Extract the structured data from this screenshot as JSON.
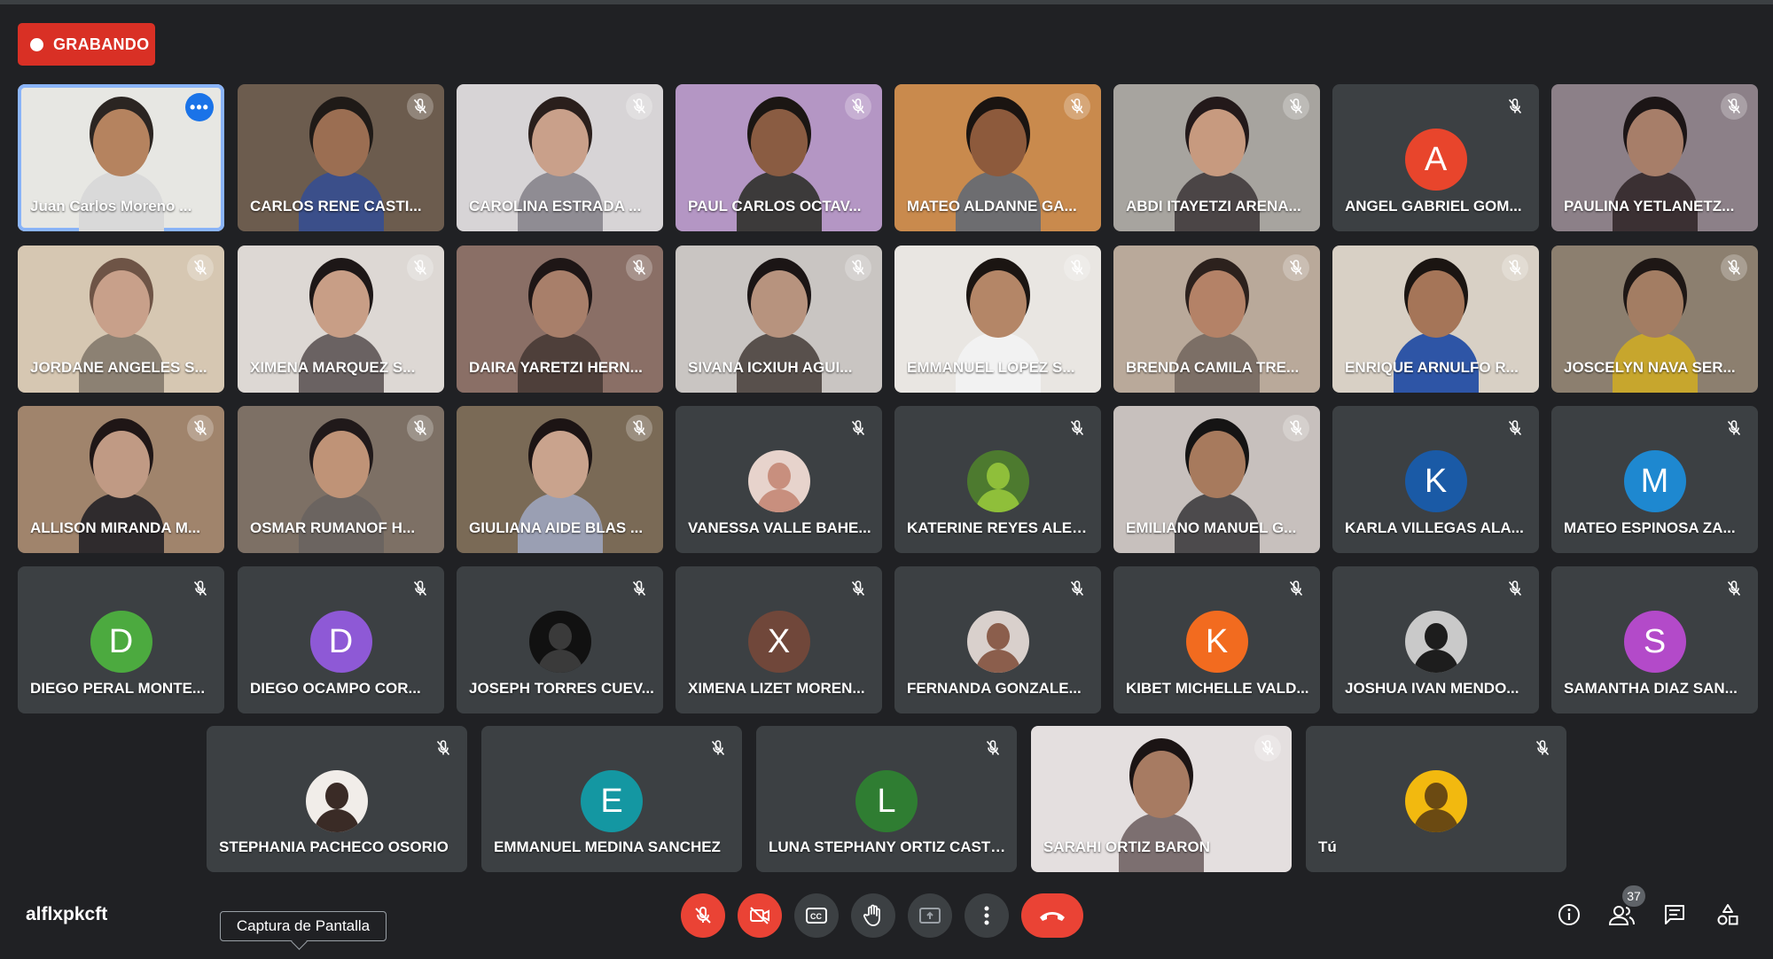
{
  "recording": {
    "label": "GRABANDO"
  },
  "meeting_code": "alflxpkcft",
  "tooltip": "Captura de Pantalla",
  "participants_count": "37",
  "participants": [
    {
      "name": "Juan Carlos Moreno ...",
      "kind": "video",
      "active": true,
      "bg": "#e7e7e3",
      "skin": "#b5835f",
      "hair": "#2b2522",
      "shirt": "#d9d9d9"
    },
    {
      "name": "CARLOS RENE CASTI...",
      "kind": "video",
      "bg": "#6c5c4e",
      "skin": "#9b6e52",
      "hair": "#1f1a17",
      "shirt": "#3b4f8a"
    },
    {
      "name": "CAROLINA ESTRADA ...",
      "kind": "video",
      "bg": "#d7d4d6",
      "skin": "#c9a08a",
      "hair": "#2a1f1c",
      "shirt": "#8f8c93"
    },
    {
      "name": "PAUL CARLOS OCTAV...",
      "kind": "video",
      "bg": "#b496c4",
      "skin": "#8a5c42",
      "hair": "#1b1613",
      "shirt": "#3c3a3a"
    },
    {
      "name": "MATEO ALDANNE GA...",
      "kind": "video",
      "bg": "#c98a4d",
      "skin": "#8d5a3c",
      "hair": "#1a1411",
      "shirt": "#6d6d70"
    },
    {
      "name": "ABDI ITAYETZI ARENA...",
      "kind": "video",
      "bg": "#a7a49f",
      "skin": "#c79a7f",
      "hair": "#23191a",
      "shirt": "#4b4546"
    },
    {
      "name": "ANGEL GABRIEL GOM...",
      "kind": "avatar",
      "letter": "A",
      "color": "#e8452c"
    },
    {
      "name": "PAULINA YETLANETZ...",
      "kind": "video",
      "bg": "#8c8088",
      "skin": "#a77e69",
      "hair": "#1c1516",
      "shirt": "#3b3033"
    },
    {
      "name": "JORDANE ANGELES S...",
      "kind": "video",
      "bg": "#d6c7b2",
      "skin": "#c8a08a",
      "hair": "#6e5446",
      "shirt": "#8c8173"
    },
    {
      "name": "XIMENA MARQUEZ S...",
      "kind": "video",
      "bg": "#ddd8d4",
      "skin": "#c89e86",
      "hair": "#1d1717",
      "shirt": "#6a6262"
    },
    {
      "name": "DAIRA YARETZI HERN...",
      "kind": "video",
      "bg": "#8a6f66",
      "skin": "#a87f6a",
      "hair": "#1e1616",
      "shirt": "#4e3f3a"
    },
    {
      "name": "SIVANA ICXIUH AGUI...",
      "kind": "video",
      "bg": "#c9c5c2",
      "skin": "#b7937e",
      "hair": "#1b1515",
      "shirt": "#58504c"
    },
    {
      "name": "EMMANUEL LOPEZ S...",
      "kind": "video",
      "bg": "#e9e6e2",
      "skin": "#b48667",
      "hair": "#1b1512",
      "shirt": "#f2f2f2"
    },
    {
      "name": "BRENDA CAMILA TRE...",
      "kind": "video",
      "bg": "#b9a99a",
      "skin": "#b48267",
      "hair": "#2c211d",
      "shirt": "#7c6f66"
    },
    {
      "name": "ENRIQUE ARNULFO R...",
      "kind": "video",
      "bg": "#d8d0c5",
      "skin": "#a57558",
      "hair": "#1b1512",
      "shirt": "#2e55a6"
    },
    {
      "name": "JOSCELYN NAVA SER...",
      "kind": "video",
      "bg": "#8c7f6f",
      "skin": "#a37d63",
      "hair": "#1e1715",
      "shirt": "#c7a62d"
    },
    {
      "name": "ALLISON MIRANDA M...",
      "kind": "video",
      "bg": "#a0846c",
      "skin": "#c09a84",
      "hair": "#1f1616",
      "shirt": "#2f2b2d"
    },
    {
      "name": "OSMAR RUMANOF H...",
      "kind": "video",
      "bg": "#7d7065",
      "skin": "#bf9377",
      "hair": "#20191a",
      "shirt": "#6b6460"
    },
    {
      "name": "GIULIANA AIDE BLAS ...",
      "kind": "video",
      "bg": "#7a6a56",
      "skin": "#c9a38d",
      "hair": "#1c1414",
      "shirt": "#9a9fb3"
    },
    {
      "name": "VANESSA VALLE BAHE...",
      "kind": "photo",
      "pc": "#e7d3cc",
      "ps": "#c88f7e"
    },
    {
      "name": "KATERINE REYES ALEG...",
      "kind": "photo",
      "pc": "#4d7a2f",
      "ps": "#8fbf3a"
    },
    {
      "name": "EMILIANO MANUEL G...",
      "kind": "video",
      "bg": "#c7c0bd",
      "skin": "#a77a5d",
      "hair": "#151414",
      "shirt": "#4c4a4c"
    },
    {
      "name": "KARLA VILLEGAS ALA...",
      "kind": "avatar",
      "letter": "K",
      "color": "#1a5aa6"
    },
    {
      "name": "MATEO ESPINOSA ZA...",
      "kind": "avatar",
      "letter": "M",
      "color": "#1e88d0"
    },
    {
      "name": "DIEGO PERAL MONTE...",
      "kind": "avatar",
      "letter": "D",
      "color": "#4caa3f"
    },
    {
      "name": "DIEGO OCAMPO COR...",
      "kind": "avatar",
      "letter": "D",
      "color": "#8e59d6"
    },
    {
      "name": "JOSEPH TORRES CUEV...",
      "kind": "photo",
      "pc": "#111111",
      "ps": "#3a3a3a"
    },
    {
      "name": "XIMENA LIZET MOREN...",
      "kind": "avatar",
      "letter": "X",
      "color": "#70473a"
    },
    {
      "name": "FERNANDA GONZALE...",
      "kind": "photo",
      "pc": "#d9d0cc",
      "ps": "#8b5e4c"
    },
    {
      "name": "KIBET MICHELLE VALD...",
      "kind": "avatar",
      "letter": "K",
      "color": "#f26b1f"
    },
    {
      "name": "JOSHUA IVAN MENDO...",
      "kind": "photo",
      "pc": "#c9c9c9",
      "ps": "#1d1d1d"
    },
    {
      "name": "SAMANTHA DIAZ SAN...",
      "kind": "avatar",
      "letter": "S",
      "color": "#b34ac9"
    },
    {
      "name": "STEPHANIA PACHECO OSORIO",
      "kind": "photo",
      "pc": "#f1ede9",
      "ps": "#3a2b26"
    },
    {
      "name": "EMMANUEL MEDINA SANCHEZ",
      "kind": "avatar",
      "letter": "E",
      "color": "#1497a2"
    },
    {
      "name": "LUNA STEPHANY ORTIZ CASTR...",
      "kind": "avatar",
      "letter": "L",
      "color": "#2f7d32"
    },
    {
      "name": "SARAHI ORTIZ BARON",
      "kind": "video",
      "bg": "#e4dfdf",
      "skin": "#a77b62",
      "hair": "#1b1414",
      "shirt": "#7c6f70"
    },
    {
      "name": "Tú",
      "kind": "photo",
      "pc": "#f2b90f",
      "ps": "#6b4a12"
    }
  ]
}
